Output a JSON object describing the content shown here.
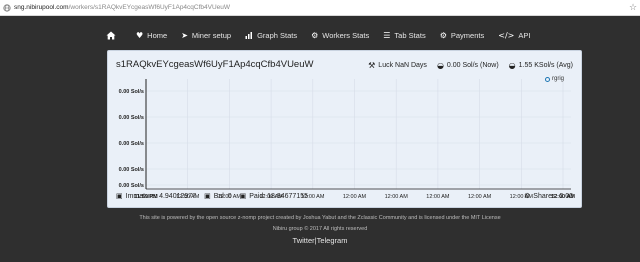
{
  "browser": {
    "url_host": "sng.nibirupool.com",
    "url_path": "/workers/s1RAQkvEYcgeasWf6UyF1Ap4cqCfb4VUeuW"
  },
  "nav": {
    "items": [
      {
        "label": "Home",
        "icon": "heart-icon"
      },
      {
        "label": "Miner setup",
        "icon": "rocket-icon"
      },
      {
        "label": "Graph Stats",
        "icon": "bar-chart-icon"
      },
      {
        "label": "Workers Stats",
        "icon": "gears-icon"
      },
      {
        "label": "Tab Stats",
        "icon": "list-icon"
      },
      {
        "label": "Payments",
        "icon": "gears-icon"
      },
      {
        "label": "API",
        "icon": "code-icon"
      }
    ]
  },
  "panel": {
    "worker": "s1RAQkvEYcgeasWf6UyF1Ap4cqCfb4VUeuW",
    "luck": "Luck NaN Days",
    "now": "0.00 Sol/s (Now)",
    "avg": "1.55 KSol/s (Avg)",
    "immature": "Immature: 4.94012977",
    "bal": "Bal: 0",
    "paid": "Paid: 18.94677155",
    "shares": "Shares: 0.00"
  },
  "chart_data": {
    "type": "line",
    "legend": [
      "rgrig"
    ],
    "y_ticks": [
      "0.00 Sol/s",
      "0.00 Sol/s",
      "0.00 Sol/s",
      "0.00 Sol/s",
      "0.00 Sol/s"
    ],
    "x_ticks": [
      "11:59 PM",
      "12:00 AM",
      "12:00 AM",
      "12:00 AM",
      "12:00 AM",
      "12:00 AM",
      "12:00 AM",
      "12:00 AM",
      "12:00 AM",
      "12:00 AM",
      "12:00 AM"
    ],
    "series": [
      {
        "name": "rgrig",
        "values": []
      }
    ],
    "grid": true,
    "legend_position": "top-right"
  },
  "footer": {
    "line1": "This site is powered by the open source z-nomp project created by Joshua Yabut and the Zclassic Community and is licensed under the MIT License",
    "line2": "Nibiru group © 2017 All rights reserved",
    "twitter": "Twitter",
    "sep": "|",
    "telegram": "Telegram"
  }
}
